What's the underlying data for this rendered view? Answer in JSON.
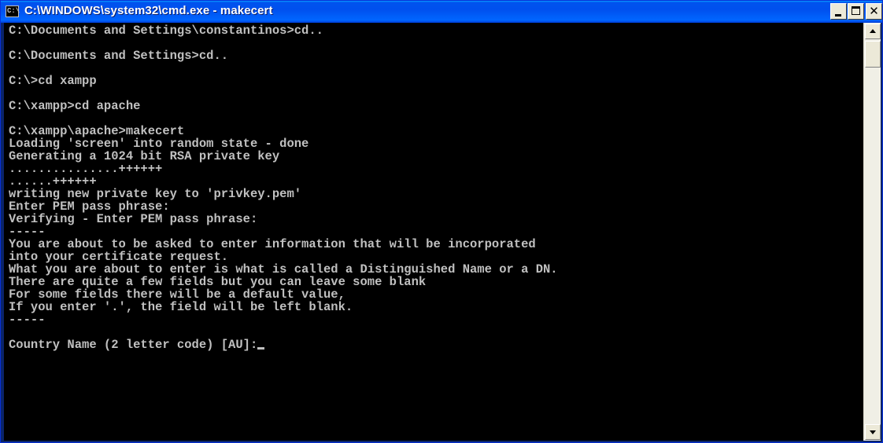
{
  "window": {
    "title": "C:\\WINDOWS\\system32\\cmd.exe - makecert",
    "icon_label": "C:\\"
  },
  "console": {
    "lines": [
      "C:\\Documents and Settings\\constantinos>cd..",
      "",
      "C:\\Documents and Settings>cd..",
      "",
      "C:\\>cd xampp",
      "",
      "C:\\xampp>cd apache",
      "",
      "C:\\xampp\\apache>makecert",
      "Loading 'screen' into random state - done",
      "Generating a 1024 bit RSA private key",
      "...............++++++",
      "......++++++",
      "writing new private key to 'privkey.pem'",
      "Enter PEM pass phrase:",
      "Verifying - Enter PEM pass phrase:",
      "-----",
      "You are about to be asked to enter information that will be incorporated",
      "into your certificate request.",
      "What you are about to enter is what is called a Distinguished Name or a DN.",
      "There are quite a few fields but you can leave some blank",
      "For some fields there will be a default value,",
      "If you enter '.', the field will be left blank.",
      "-----",
      "",
      "Country Name (2 letter code) [AU]:"
    ]
  },
  "colors": {
    "console_bg": "#000000",
    "console_text": "#c0c0c0",
    "titlebar": "#0053ee"
  },
  "icons": {
    "app": "cmd-icon",
    "minimize": "minimize-icon",
    "maximize": "maximize-icon",
    "close": "close-icon",
    "scroll_up": "arrow-up-icon",
    "scroll_down": "arrow-down-icon"
  }
}
